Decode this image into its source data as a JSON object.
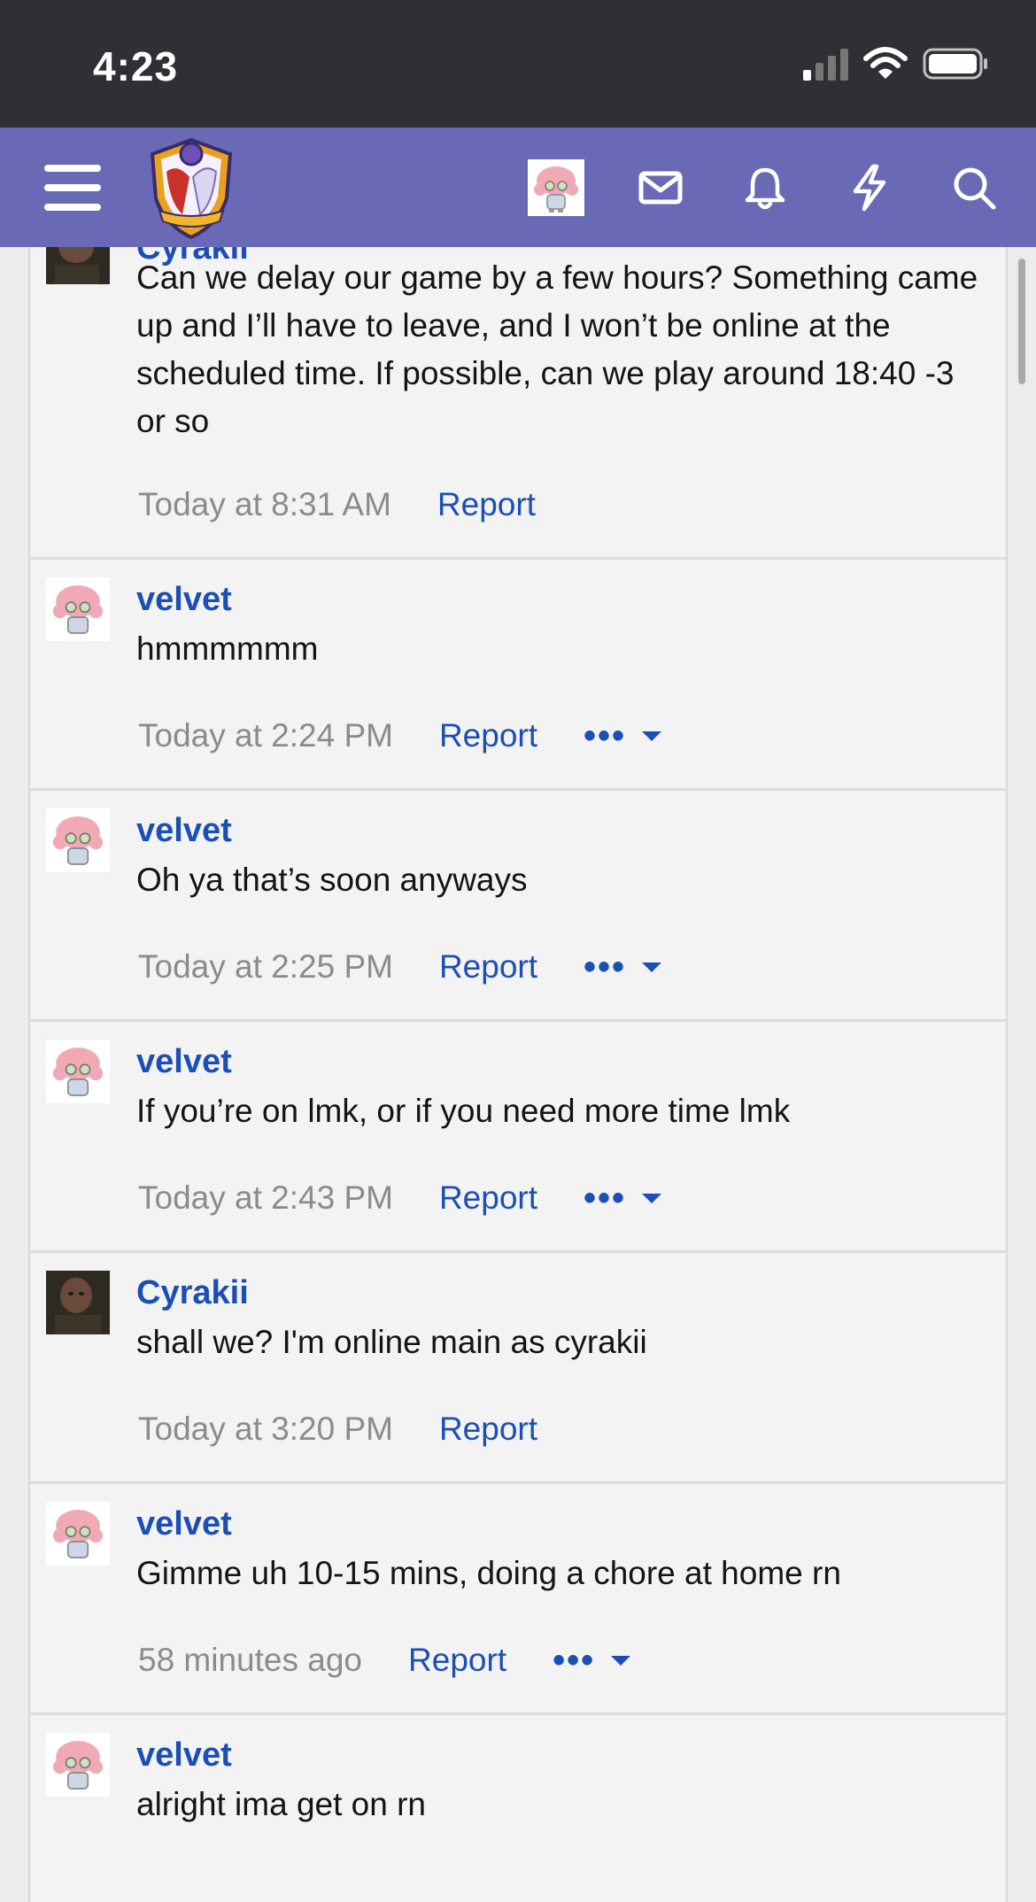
{
  "status_bar": {
    "time": "4:23",
    "signal_icon": "cellular-signal-icon",
    "wifi_icon": "wifi-icon",
    "battery_icon": "battery-icon"
  },
  "nav_bar": {
    "background": "#6a69b5",
    "menu_icon": "hamburger-menu-icon",
    "logo": "site-logo-crest",
    "account_avatar": "user-avatar",
    "icons": [
      "mail-icon",
      "bell-icon",
      "lightning-icon",
      "search-icon"
    ]
  },
  "link_color": "#1b4fb5",
  "messages": [
    {
      "author": "Cyrakii",
      "text": "Can we delay our game by a few hours? Something came up and I’ll have to leave, and I won’t be online at the scheduled time. If possible, can we play around 18:40 -3 or so",
      "time": "Today at 8:31 AM",
      "report": "Report"
    },
    {
      "author": "velvet",
      "text": "hmmmmmm",
      "time": "Today at 2:24 PM",
      "report": "Report",
      "more": "•••"
    },
    {
      "author": "velvet",
      "text": "Oh ya that’s soon anyways",
      "time": "Today at 2:25 PM",
      "report": "Report",
      "more": "•••"
    },
    {
      "author": "velvet",
      "text": "If you’re on lmk, or if you need more time lmk",
      "time": "Today at 2:43 PM",
      "report": "Report",
      "more": "•••"
    },
    {
      "author": "Cyrakii",
      "text": "shall we? I'm online main as cyrakii",
      "time": "Today at 3:20 PM",
      "report": "Report"
    },
    {
      "author": "velvet",
      "text": "Gimme uh 10-15 mins, doing a chore at home rn",
      "time": "58 minutes ago",
      "report": "Report",
      "more": "•••"
    },
    {
      "author": "velvet",
      "text": "alright ima get on rn"
    }
  ]
}
